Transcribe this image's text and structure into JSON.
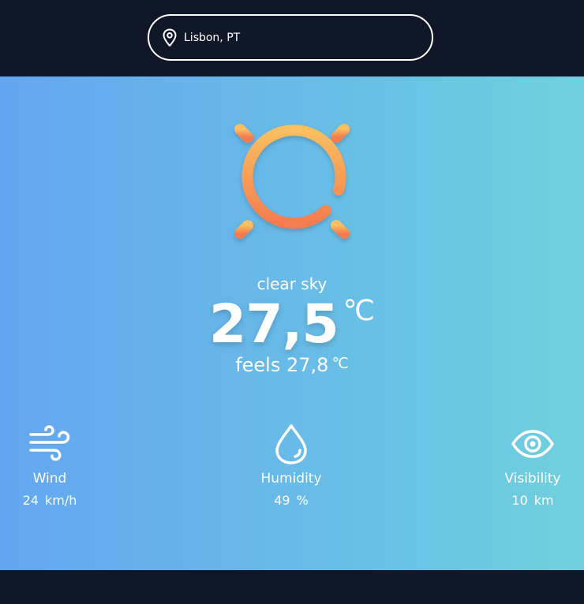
{
  "search": {
    "icon": "map-pin-icon",
    "value": "Lisbon, PT"
  },
  "weather": {
    "icon": "sun-icon",
    "condition": "clear sky",
    "temperature": "27,5",
    "temperature_unit": "℃",
    "feels_label": "feels",
    "feels_value": "27,8",
    "feels_unit": "℃"
  },
  "stats": [
    {
      "icon": "wind-icon",
      "label": "Wind",
      "value": "24",
      "unit": "km/h"
    },
    {
      "icon": "droplet-icon",
      "label": "Humidity",
      "value": "49",
      "unit": "%"
    },
    {
      "icon": "eye-icon",
      "label": "Visibility",
      "value": "10",
      "unit": "km"
    }
  ],
  "colors": {
    "background_dark": "#0f1729",
    "gradient_start": "#64a6f1",
    "gradient_end": "#71d0dd",
    "sun_light": "#fbbf60",
    "sun_dark": "#f57c4f"
  }
}
